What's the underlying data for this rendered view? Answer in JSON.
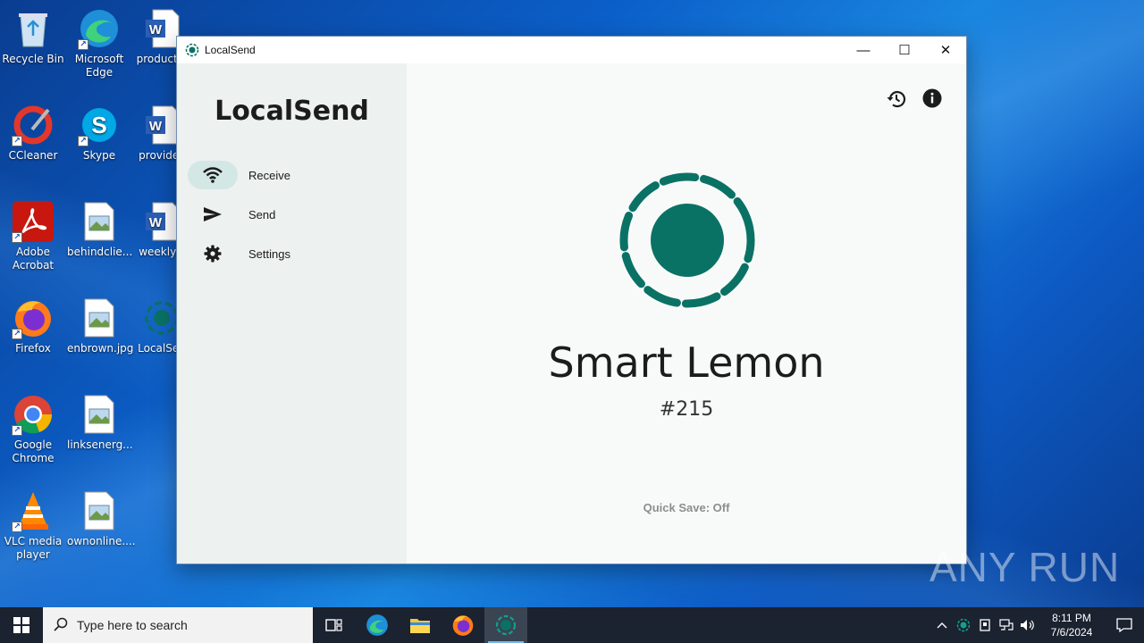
{
  "desktop": {
    "icons": [
      {
        "label": "Recycle Bin",
        "icon": "recycle-bin-icon"
      },
      {
        "label": "Microsoft Edge",
        "icon": "edge-icon"
      },
      {
        "label": "productio",
        "icon": "word-doc-icon"
      },
      {
        "label": "CCleaner",
        "icon": "ccleaner-icon"
      },
      {
        "label": "Skype",
        "icon": "skype-icon"
      },
      {
        "label": "providec",
        "icon": "word-doc-icon"
      },
      {
        "label": "Adobe Acrobat",
        "icon": "acrobat-icon"
      },
      {
        "label": "behindclie...",
        "icon": "image-file-icon"
      },
      {
        "label": "weeklysi",
        "icon": "word-doc-icon"
      },
      {
        "label": "Firefox",
        "icon": "firefox-icon"
      },
      {
        "label": "enbrown.jpg",
        "icon": "image-file-icon"
      },
      {
        "label": "LocalSen",
        "icon": "localsend-icon"
      },
      {
        "label": "Google Chrome",
        "icon": "chrome-icon"
      },
      {
        "label": "linksenerg...",
        "icon": "image-file-icon"
      },
      {
        "label": "VLC media player",
        "icon": "vlc-icon"
      },
      {
        "label": "ownonline....",
        "icon": "image-file-icon"
      }
    ]
  },
  "window": {
    "title": "LocalSend",
    "controls": {
      "minimize": "—",
      "maximize": "☐",
      "close": "✕"
    }
  },
  "sidebar": {
    "brand": "LocalSend",
    "items": [
      {
        "label": "Receive",
        "icon": "wifi-icon",
        "active": true
      },
      {
        "label": "Send",
        "icon": "send-icon",
        "active": false
      },
      {
        "label": "Settings",
        "icon": "gear-icon",
        "active": false
      }
    ]
  },
  "main": {
    "device_name": "Smart Lemon",
    "device_id": "#215",
    "quick_save": "Quick Save: Off",
    "accent_color": "#0a7265"
  },
  "watermark": "ANY RUN",
  "taskbar": {
    "search_placeholder": "Type here to search",
    "time": "8:11 PM",
    "date": "7/6/2024"
  }
}
